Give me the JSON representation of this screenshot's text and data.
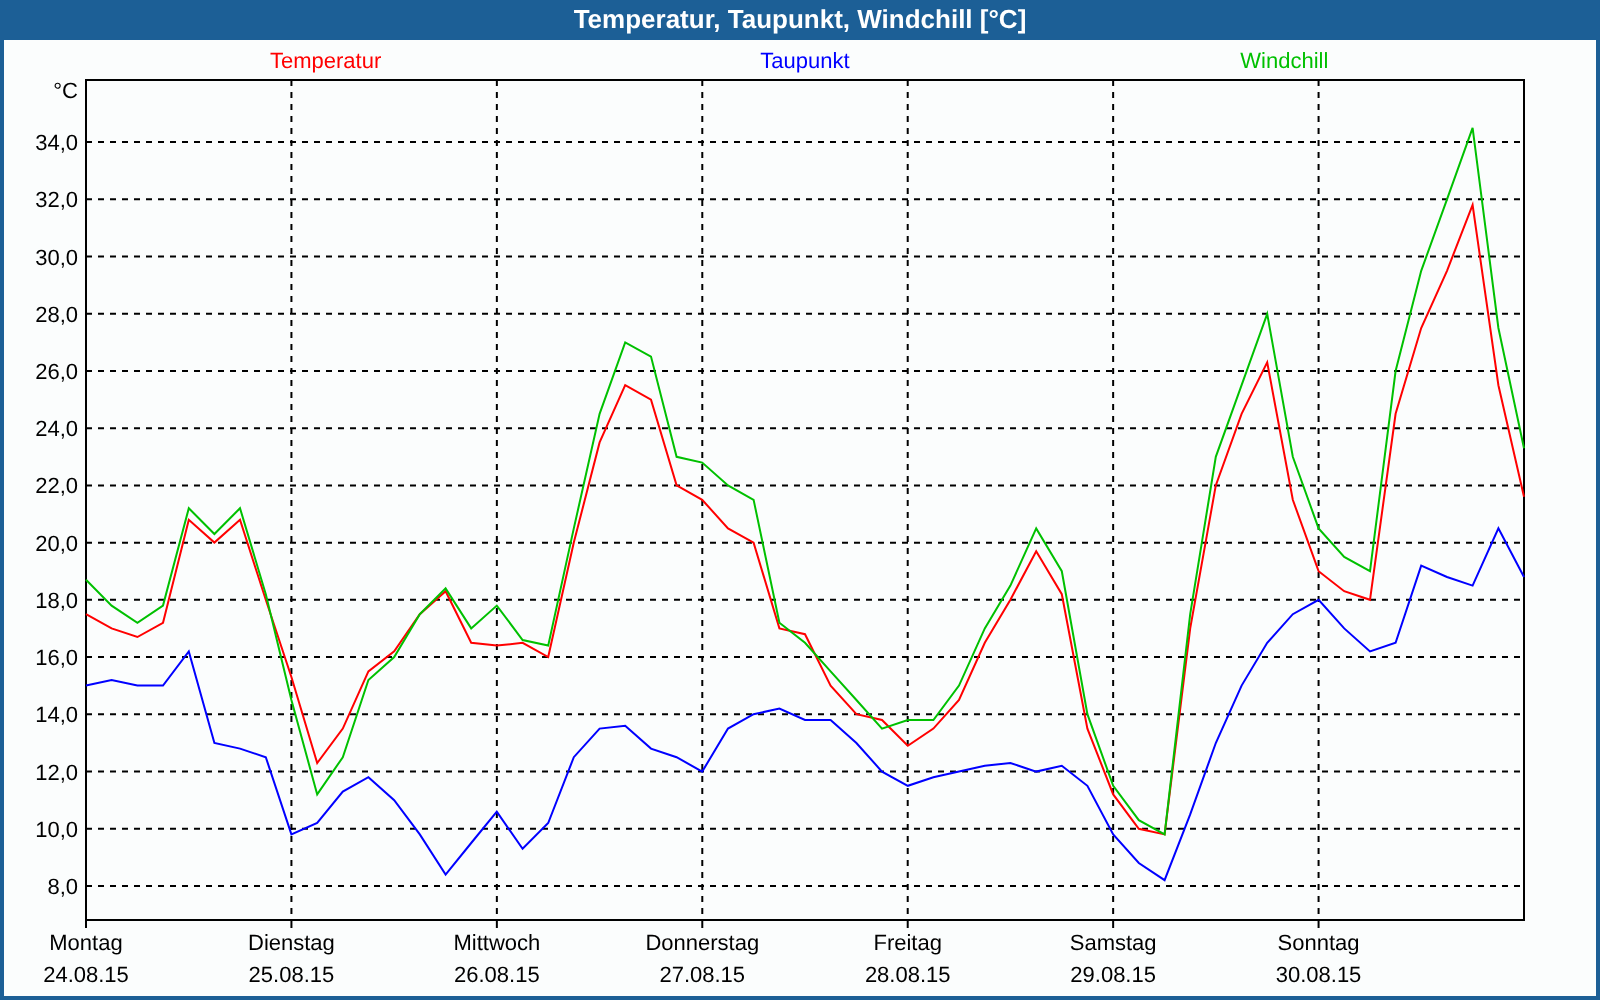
{
  "window": {
    "title": "Temperatur, Taupunkt, Windchill [°C]"
  },
  "chart": {
    "chart_data": {
      "type": "line",
      "grid": true,
      "ylabel": "°C",
      "ylim": [
        6.81,
        36.17
      ],
      "categories": [
        "Montag 24.08.15",
        null,
        null,
        null,
        null,
        null,
        null,
        null,
        "Dienstag 25.08.15",
        null,
        null,
        null,
        null,
        null,
        null,
        null,
        "Mittwoch 26.08.15",
        null,
        null,
        null,
        null,
        null,
        null,
        null,
        "Donnerstag 27.08.15",
        null,
        null,
        null,
        null,
        null,
        null,
        null,
        "Freitag 28.08.15",
        null,
        null,
        null,
        null,
        null,
        null,
        null,
        "Samstag 29.08.15",
        null,
        null,
        null,
        null,
        null,
        null,
        null,
        "Sonntag 30.08.15",
        null,
        null,
        null,
        null,
        null,
        null,
        null,
        null
      ],
      "yticks": [
        {
          "value": 8,
          "label": "8,0"
        },
        {
          "value": 10,
          "label": "10,0"
        },
        {
          "value": 12,
          "label": "12,0"
        },
        {
          "value": 14,
          "label": "14,0"
        },
        {
          "value": 16,
          "label": "16,0"
        },
        {
          "value": 18,
          "label": "18,0"
        },
        {
          "value": 20,
          "label": "20,0"
        },
        {
          "value": 22,
          "label": "22,0"
        },
        {
          "value": 24,
          "label": "24,0"
        },
        {
          "value": 26,
          "label": "26,0"
        },
        {
          "value": 28,
          "label": "28,0"
        },
        {
          "value": 30,
          "label": "30,0"
        },
        {
          "value": 32,
          "label": "32,0"
        },
        {
          "value": 34,
          "label": "34,0"
        }
      ],
      "series": [
        {
          "name": "Temperatur",
          "color": "#ff0000",
          "values": [
            17.5,
            17.0,
            16.7,
            17.2,
            20.8,
            20.0,
            20.8,
            18.0,
            15.3,
            12.3,
            13.5,
            15.5,
            16.2,
            17.5,
            18.3,
            16.5,
            16.4,
            16.5,
            16.0,
            20.0,
            23.5,
            25.5,
            25.0,
            22.0,
            21.5,
            20.5,
            20.0,
            17.0,
            16.8,
            15.0,
            14.0,
            13.8,
            12.9,
            13.5,
            14.5,
            16.5,
            18.0,
            19.7,
            18.2,
            13.5,
            11.2,
            10.0,
            9.8,
            17.0,
            22.0,
            24.5,
            26.3,
            21.5,
            19.0,
            18.3,
            18.0,
            24.5,
            27.5,
            29.5,
            31.8,
            25.5,
            21.6
          ]
        },
        {
          "name": "Taupunkt",
          "color": "#0000ff",
          "values": [
            15.0,
            15.2,
            15.0,
            15.0,
            16.2,
            13.0,
            12.8,
            12.5,
            9.8,
            10.2,
            11.3,
            11.8,
            11.0,
            9.8,
            8.4,
            9.5,
            10.6,
            9.3,
            10.2,
            12.5,
            13.5,
            13.6,
            12.8,
            12.5,
            12.0,
            13.5,
            14.0,
            14.2,
            13.8,
            13.8,
            13.0,
            12.0,
            11.5,
            11.8,
            12.0,
            12.2,
            12.3,
            12.0,
            12.2,
            11.5,
            9.8,
            8.8,
            8.2,
            10.5,
            13.0,
            15.0,
            16.5,
            17.5,
            18.0,
            17.0,
            16.2,
            16.5,
            19.2,
            18.8,
            18.5,
            20.5,
            18.8
          ]
        },
        {
          "name": "Windchill",
          "color": "#00c000",
          "values": [
            18.7,
            17.8,
            17.2,
            17.8,
            21.2,
            20.3,
            21.2,
            18.2,
            14.5,
            11.2,
            12.5,
            15.2,
            16.0,
            17.5,
            18.4,
            17.0,
            17.8,
            16.6,
            16.4,
            20.5,
            24.5,
            27.0,
            26.5,
            23.0,
            22.8,
            22.0,
            21.5,
            17.2,
            16.5,
            15.5,
            14.5,
            13.5,
            13.8,
            13.8,
            15.0,
            17.0,
            18.5,
            20.5,
            19.0,
            14.0,
            11.5,
            10.3,
            9.8,
            17.5,
            23.0,
            25.5,
            28.0,
            23.0,
            20.5,
            19.5,
            19.0,
            26.0,
            29.5,
            32.0,
            34.5,
            27.5,
            23.3
          ]
        }
      ]
    }
  }
}
